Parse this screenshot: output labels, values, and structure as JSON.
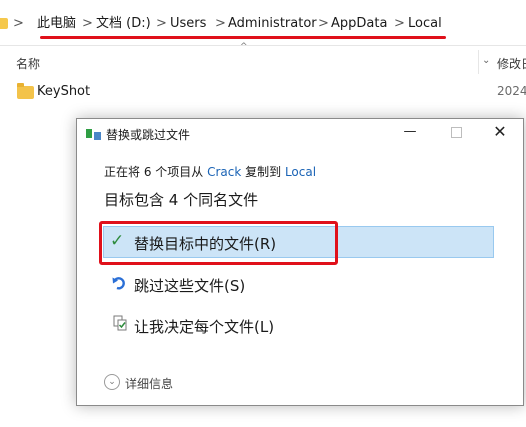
{
  "address_bar": {
    "crumbs": [
      "此电脑",
      "文档 (D:)",
      "Users",
      "Administrator",
      "AppData",
      "Local"
    ],
    "separator": ">"
  },
  "columns": {
    "sort_indicator": "^",
    "name": "名称",
    "dropdown": "⌄",
    "date": "修改日"
  },
  "files": [
    {
      "name": "KeyShot",
      "date": "2024"
    }
  ],
  "dialog": {
    "title": "替换或跳过文件",
    "minimize": "—",
    "close": "✕",
    "progress": {
      "prefix": "正在将 6 个项目从 ",
      "source": "Crack",
      "middle": " 复制到 ",
      "dest": "Local"
    },
    "heading": "目标包含 4 个同名文件",
    "options": [
      {
        "label": "替换目标中的文件(R)",
        "icon": "checkmark-icon",
        "selected": true
      },
      {
        "label": "跳过这些文件(S)",
        "icon": "skip-icon"
      },
      {
        "label": "让我决定每个文件(L)",
        "icon": "decide-icon"
      }
    ],
    "details": {
      "label": "详细信息",
      "chevron": "⌄"
    }
  },
  "colors": {
    "highlight": "#cce4f7",
    "annotation_red": "#e0101a",
    "link": "#1a63b5"
  }
}
